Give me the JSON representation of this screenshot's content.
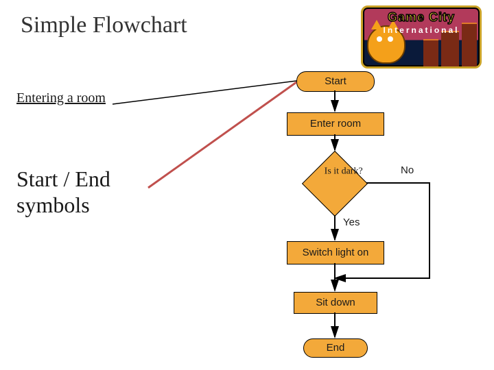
{
  "slide": {
    "title": "Simple Flowchart",
    "subtitle": "Entering a room",
    "side_label_line1": "Start / End",
    "side_label_line2": "symbols"
  },
  "logo": {
    "line1": "Game City",
    "line2": "International"
  },
  "flowchart": {
    "nodes": {
      "start": "Start",
      "enter_room": "Enter room",
      "decision": "Is it dark?",
      "switch_light": "Switch light on",
      "sit_down": "Sit down",
      "end": "End"
    },
    "labels": {
      "yes": "Yes",
      "no": "No"
    },
    "edges": [
      {
        "from": "start",
        "to": "enter_room"
      },
      {
        "from": "enter_room",
        "to": "decision"
      },
      {
        "from": "decision",
        "to": "switch_light",
        "label": "Yes"
      },
      {
        "from": "decision",
        "to": "sit_down",
        "via": "right-bypass",
        "label": "No"
      },
      {
        "from": "switch_light",
        "to": "sit_down"
      },
      {
        "from": "sit_down",
        "to": "end"
      }
    ],
    "callout": {
      "from_text": "Start / End symbols",
      "to_node": "start"
    }
  }
}
